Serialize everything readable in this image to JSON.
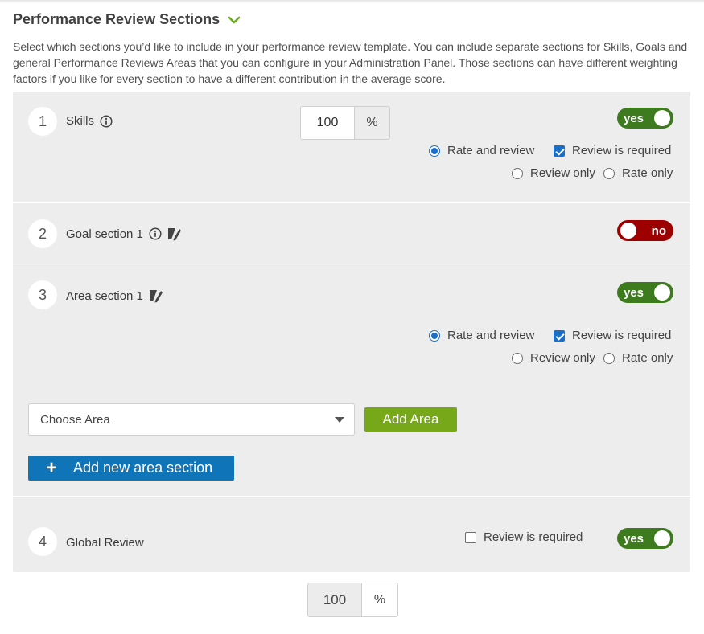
{
  "title": "Performance Review Sections",
  "description": "Select which sections you’d like to include in your performance review template. You can include separate sections for Skills, Goals and general Performance Reviews Areas that you can configure in your Administration Panel. Those sections can have different weighting factors if you like for every section to have a different contribution in the average score.",
  "sections": [
    {
      "number": "1",
      "label": "Skills",
      "weight_value": "100",
      "weight_unit": "%",
      "toggle": "yes",
      "options": {
        "rate_and_review": "Rate and review",
        "review_is_required": "Review is required",
        "review_only": "Review only",
        "rate_only": "Rate only",
        "selected": "rate_and_review",
        "review_required_checked": true
      }
    },
    {
      "number": "2",
      "label": "Goal section 1",
      "toggle": "no"
    },
    {
      "number": "3",
      "label": "Area section 1",
      "toggle": "yes",
      "options": {
        "rate_and_review": "Rate and review",
        "review_is_required": "Review is required",
        "review_only": "Review only",
        "rate_only": "Rate only",
        "selected": "rate_and_review",
        "review_required_checked": true
      },
      "choose_area_placeholder": "Choose Area",
      "add_area_label": "Add Area",
      "add_new_area_section_label": "Add new area section"
    },
    {
      "number": "4",
      "label": "Global Review",
      "review_is_required": "Review is required",
      "review_required_checked": false,
      "toggle": "yes"
    }
  ],
  "total": {
    "value": "100",
    "unit": "%"
  },
  "colors": {
    "toggle_yes": "#3e7a1e",
    "toggle_no": "#9c0000",
    "add_area": "#77a81a",
    "add_section": "#0f74b8",
    "accent_check": "#1b6fc7",
    "chevron": "#6aaa1e"
  },
  "icons": {
    "title_chevron": "chevron-down-icon",
    "info": "info-icon",
    "edit": "edit-icon",
    "plus": "plus-icon"
  }
}
